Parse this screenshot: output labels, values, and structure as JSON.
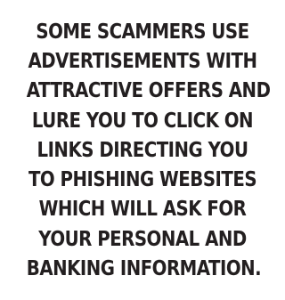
{
  "message": {
    "lines": [
      "SOME SCAMMERS USE",
      "ADVERTISEMENTS WITH",
      "ATTRACTIVE OFFERS AND",
      "LURE YOU TO CLICK ON",
      "LINKS DIRECTING YOU",
      "TO PHISHING WEBSITES",
      "WHICH WILL ASK FOR",
      "YOUR PERSONAL AND",
      "BANKING INFORMATION."
    ]
  },
  "colors": {
    "text": "#231f20",
    "background": "#ffffff"
  }
}
